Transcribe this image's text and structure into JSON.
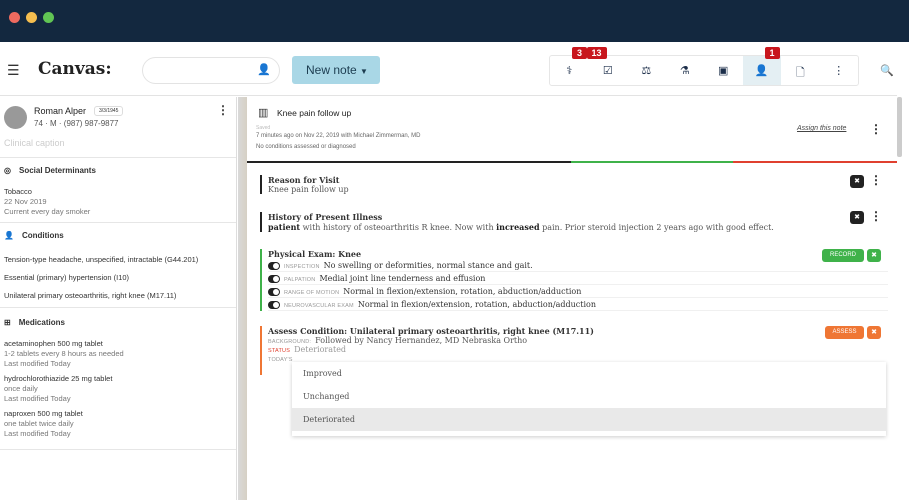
{
  "window": {
    "colors": {
      "close": "#ee6a5f",
      "min": "#f5be4f",
      "max": "#61c554"
    }
  },
  "nav": {
    "logo": "Canvas:",
    "new_note": "New note",
    "icons": [
      {
        "name": "caduceus-icon",
        "glyph": "⚕",
        "badge": "3"
      },
      {
        "name": "checkbox-icon",
        "glyph": "☑",
        "badge": "13"
      },
      {
        "name": "scales-icon",
        "glyph": "⚖",
        "badge": null
      },
      {
        "name": "flask-icon",
        "glyph": "⚗",
        "badge": null
      },
      {
        "name": "image-icon",
        "glyph": "▣",
        "badge": null
      },
      {
        "name": "doctor-icon",
        "glyph": "👤",
        "badge": "1"
      },
      {
        "name": "document-icon",
        "glyph": "🗋",
        "badge": null
      },
      {
        "name": "more-icon",
        "glyph": "⋮",
        "badge": null
      }
    ]
  },
  "patient": {
    "name": "Roman Alper",
    "dob": "3/3/1945",
    "info": "74 · M · (987) 987-9877",
    "caption": "Clinical caption"
  },
  "social": {
    "title": "Social Determinants",
    "item": "Tobacco",
    "date": "22 Nov 2019",
    "status": "Current every day smoker"
  },
  "conditions": {
    "title": "Conditions",
    "items": [
      "Tension-type headache, unspecified, intractable (G44.201)",
      "Essential (primary) hypertension (I10)",
      "Unilateral primary osteoarthritis, right knee (M17.11)"
    ]
  },
  "medications": {
    "title": "Medications",
    "items": [
      {
        "name": "acetaminophen 500 mg tablet",
        "sig": "1-2 tablets every 8 hours as needed",
        "mod": "Last modified Today"
      },
      {
        "name": "hydrochlorothiazide 25 mg tablet",
        "sig": "once daily",
        "mod": "Last modified Today"
      },
      {
        "name": "naproxen 500 mg tablet",
        "sig": "one tablet twice daily",
        "mod": "Last modified Today"
      }
    ]
  },
  "note": {
    "title": "Knee pain follow up",
    "saved": "Saved",
    "meta": "7 minutes ago on Nov 22, 2019 with Michael Zimmerman, MD",
    "conditions": "No conditions assessed or diagnosed",
    "assign": "Assign this note"
  },
  "rfv": {
    "title": "Reason for Visit",
    "body": "Knee pain follow up"
  },
  "hpi": {
    "title": "History of Present Illness",
    "b1": "patient",
    "t1": " with history of osteoarthritis R knee.  Now with ",
    "b2": "increased",
    "t2": " pain.  Prior steroid injection 2 years ago with good effect."
  },
  "exam": {
    "title": "Physical Exam: Knee",
    "button": "RECORD",
    "rows": [
      {
        "label": "Inspection",
        "value": "No swelling or deformities, normal stance and gait."
      },
      {
        "label": "Palpation",
        "value": "Medial joint line tenderness and effusion"
      },
      {
        "label": "Range of motion",
        "value": "Normal in flexion/extension, rotation, abduction/adduction"
      },
      {
        "label": "Neurovascular exam",
        "value": "Normal in flexion/extension, rotation, abduction/adduction"
      }
    ]
  },
  "assess": {
    "title": "Assess Condition: Unilateral primary osteoarthritis, right knee  (M17.11)",
    "button": "ASSESS",
    "bg_label": "Background:",
    "bg_value": "Followed by Nancy Hernandez, MD Nebraska Ortho",
    "status_label": "Status",
    "status_value": "Deteriorated",
    "today_label": "Today's",
    "options": [
      "Improved",
      "Unchanged",
      "Deteriorated"
    ]
  }
}
